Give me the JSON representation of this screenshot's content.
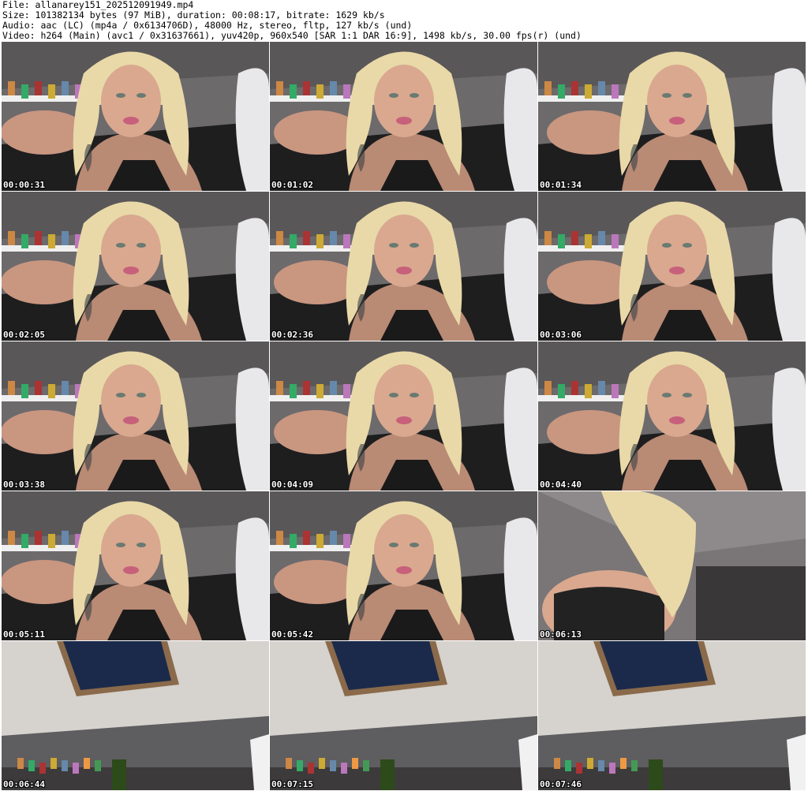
{
  "header": {
    "file_line": "File: allanarey151_202512091949.mp4",
    "size_line": "Size: 101382134 bytes (97 MiB), duration: 00:08:17, bitrate: 1629 kb/s",
    "audio_line": "Audio: aac (LC) (mp4a / 0x6134706D), 48000 Hz, stereo, fltp, 127 kb/s (und)",
    "video_line": "Video: h264 (Main) (avc1 / 0x31637661), yuv420p, 960x540 [SAR 1:1 DAR 16:9], 1498 kb/s, 30.00 fps(r) (und)"
  },
  "thumbnails": [
    {
      "timestamp": "00:00:31",
      "scene": "bedroom-person"
    },
    {
      "timestamp": "00:01:02",
      "scene": "bedroom-person"
    },
    {
      "timestamp": "00:01:34",
      "scene": "bedroom-person"
    },
    {
      "timestamp": "00:02:05",
      "scene": "bedroom-person"
    },
    {
      "timestamp": "00:02:36",
      "scene": "bedroom-person"
    },
    {
      "timestamp": "00:03:06",
      "scene": "bedroom-person"
    },
    {
      "timestamp": "00:03:38",
      "scene": "bedroom-person"
    },
    {
      "timestamp": "00:04:09",
      "scene": "bedroom-person"
    },
    {
      "timestamp": "00:04:40",
      "scene": "bedroom-person"
    },
    {
      "timestamp": "00:05:11",
      "scene": "bedroom-person"
    },
    {
      "timestamp": "00:05:42",
      "scene": "bedroom-person"
    },
    {
      "timestamp": "00:06:13",
      "scene": "bedroom-person-standing"
    },
    {
      "timestamp": "00:06:44",
      "scene": "ceiling-window"
    },
    {
      "timestamp": "00:07:15",
      "scene": "ceiling-window"
    },
    {
      "timestamp": "00:07:46",
      "scene": "ceiling-window"
    }
  ],
  "colors": {
    "wall": "#6d6a6c",
    "bedding": "#1e1e1f",
    "skin": "#d9a88f",
    "hair": "#e9d9a8",
    "ceiling": "#d6d2cd",
    "window": "#1b2a4a",
    "window_frame": "#8a6a4a"
  }
}
